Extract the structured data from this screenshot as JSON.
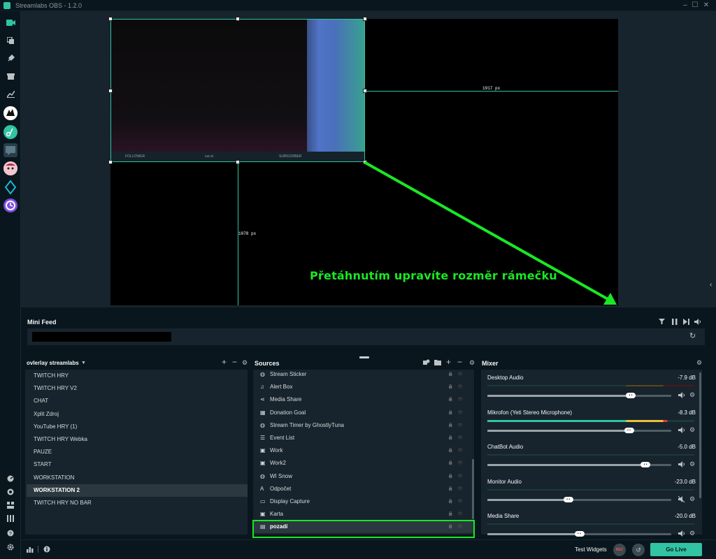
{
  "app": {
    "title": "Streamlabs OBS - 1.2.0",
    "win_min": "–",
    "win_max": "☐",
    "win_close": "✕"
  },
  "editor": {
    "guide_width_label": "1917 px",
    "guide_height_label": "1078 px",
    "annotation": "Přetáhnutím upravíte rozměr rámečku",
    "frame_bar_left": "FOLLOWER",
    "frame_bar_mid": "cur.st",
    "frame_bar_right": "SUBSCRIBER"
  },
  "minifeed": {
    "title": "Mini Feed"
  },
  "scenes": {
    "title": "ovlerlay streamlabs",
    "items": [
      "TWITCH HRY",
      "TWITCH HRY V2",
      "CHAT",
      "Xplit Zdroj",
      "YouTube HRY (1)",
      "TWITCH HRY Webka",
      "PAUZE",
      "START",
      "WORKSTATION",
      "WORKSTATION 2",
      "TWITCH HRY NO BAR"
    ],
    "active": "WORKSTATION 2"
  },
  "sources": {
    "title": "Sources",
    "items": [
      {
        "label": "Stream Sticker",
        "icon": "globe-icon"
      },
      {
        "label": "Alert Box",
        "icon": "bell-icon"
      },
      {
        "label": "Media Share",
        "icon": "share-icon"
      },
      {
        "label": "Donation Goal",
        "icon": "calendar-icon"
      },
      {
        "label": "Stream Timer by GhostlyTuna",
        "icon": "globe-icon"
      },
      {
        "label": "Event List",
        "icon": "list-icon"
      },
      {
        "label": "Work",
        "icon": "image-icon"
      },
      {
        "label": "Work2",
        "icon": "image-icon"
      },
      {
        "label": "WI Snow",
        "icon": "globe-icon"
      },
      {
        "label": "Odpočet",
        "icon": "text-icon"
      },
      {
        "label": "Display Capture",
        "icon": "monitor-icon"
      },
      {
        "label": "Karta",
        "icon": "image-icon"
      },
      {
        "label": "pozadí",
        "icon": "file-icon"
      }
    ],
    "active": "pozadí"
  },
  "mixer": {
    "title": "Mixer",
    "channels": [
      {
        "name": "Desktop Audio",
        "db": "-7.9 dB",
        "volume": 0.78
      },
      {
        "name": "Mikrofon (Yeti Stereo Microphone)",
        "db": "-8.3 dB",
        "volume": 0.77
      },
      {
        "name": "ChatBot Audio",
        "db": "-5.0 dB",
        "volume": 0.86
      },
      {
        "name": "Monitor Audio",
        "db": "-23.0 dB",
        "volume": 0.44
      },
      {
        "name": "Media Share",
        "db": "-20.0 dB",
        "volume": 0.5
      }
    ]
  },
  "footer": {
    "test_widgets": "Test Widgets",
    "rec": "REC",
    "go_live": "Go Live"
  },
  "colors": {
    "accent": "#31c3a2",
    "annotation": "#19e824",
    "background": "#09161d",
    "panel": "#17242d"
  }
}
